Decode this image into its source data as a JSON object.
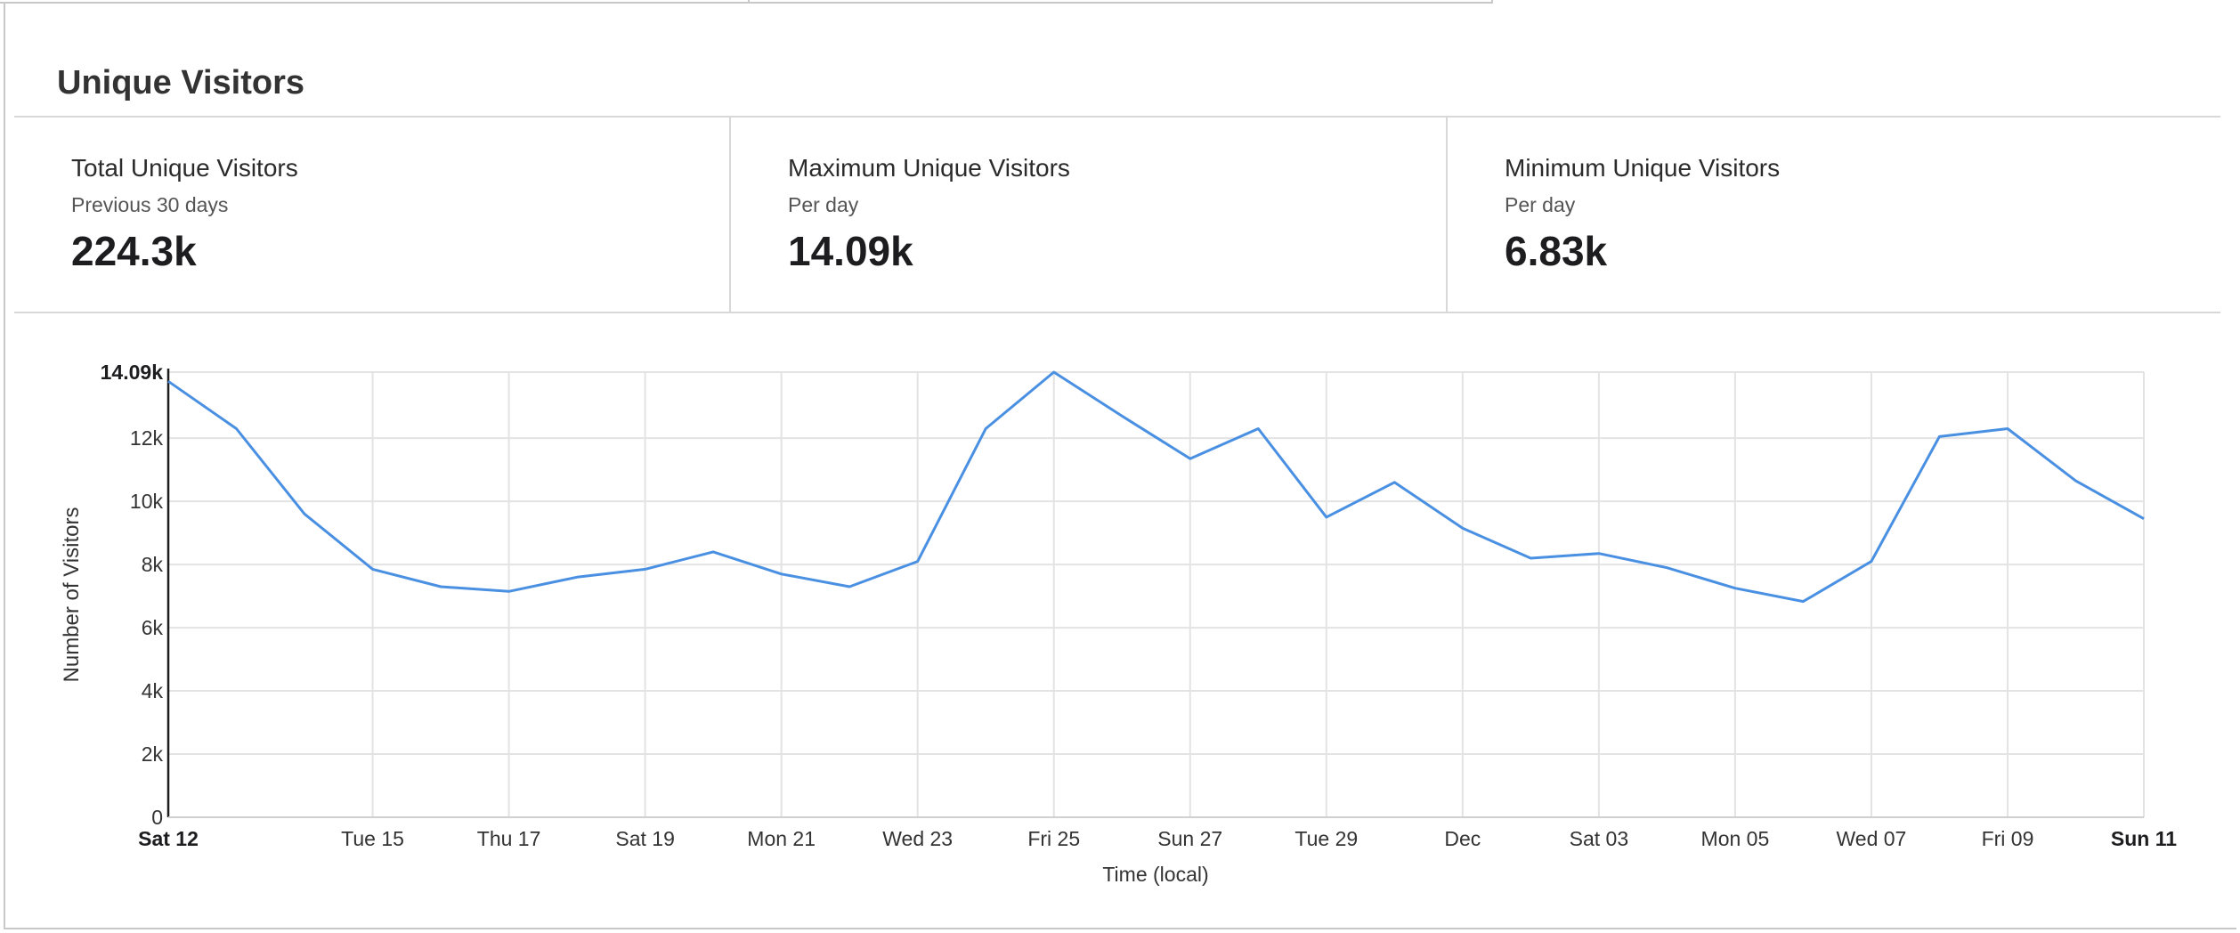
{
  "panel": {
    "title": "Unique Visitors",
    "stats": [
      {
        "label": "Total Unique Visitors",
        "sub": "Previous 30 days",
        "value": "224.3k"
      },
      {
        "label": "Maximum Unique Visitors",
        "sub": "Per day",
        "value": "14.09k"
      },
      {
        "label": "Minimum Unique Visitors",
        "sub": "Per day",
        "value": "6.83k"
      }
    ]
  },
  "chart_data": {
    "type": "line",
    "xlabel": "Time (local)",
    "ylabel": "Number of Visitors",
    "ylim": [
      0,
      14090
    ],
    "y_ticks": [
      {
        "value": 0,
        "label": "0"
      },
      {
        "value": 2000,
        "label": "2k"
      },
      {
        "value": 4000,
        "label": "4k"
      },
      {
        "value": 6000,
        "label": "6k"
      },
      {
        "value": 8000,
        "label": "8k"
      },
      {
        "value": 10000,
        "label": "10k"
      },
      {
        "value": 12000,
        "label": "12k"
      },
      {
        "value": 14090,
        "label": "14.09k"
      }
    ],
    "x_ticks": [
      {
        "day": 0,
        "label": "Sat 12"
      },
      {
        "day": 3,
        "label": "Tue 15"
      },
      {
        "day": 5,
        "label": "Thu 17"
      },
      {
        "day": 7,
        "label": "Sat 19"
      },
      {
        "day": 9,
        "label": "Mon 21"
      },
      {
        "day": 11,
        "label": "Wed 23"
      },
      {
        "day": 13,
        "label": "Fri 25"
      },
      {
        "day": 15,
        "label": "Sun 27"
      },
      {
        "day": 17,
        "label": "Tue 29"
      },
      {
        "day": 19,
        "label": "Dec"
      },
      {
        "day": 21,
        "label": "Sat 03"
      },
      {
        "day": 23,
        "label": "Mon 05"
      },
      {
        "day": 25,
        "label": "Wed 07"
      },
      {
        "day": 27,
        "label": "Fri 09"
      },
      {
        "day": 29,
        "label": "Sun 11"
      }
    ],
    "grid": true,
    "color": "#4a90e2",
    "x": [
      0,
      1,
      2,
      3,
      4,
      5,
      6,
      7,
      8,
      9,
      10,
      11,
      12,
      13,
      14,
      15,
      16,
      17,
      18,
      19,
      20,
      21,
      22,
      23,
      24,
      25,
      26,
      27,
      28,
      29
    ],
    "values": [
      13800,
      12300,
      9600,
      7850,
      7300,
      7150,
      7600,
      7850,
      8400,
      7700,
      7300,
      8100,
      12300,
      14090,
      12700,
      11350,
      12300,
      9500,
      10600,
      9150,
      8200,
      8350,
      7900,
      7250,
      6830,
      8100,
      12050,
      12300,
      10650,
      9450
    ]
  }
}
